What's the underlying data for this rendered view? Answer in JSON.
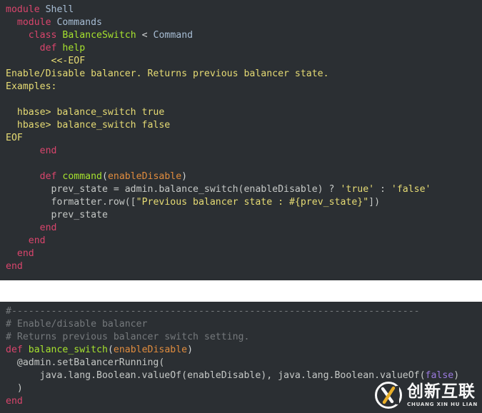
{
  "theme": {
    "panel_background": "#2b2f33",
    "page_background": "#ffffff",
    "default_text": "#c5c8c6",
    "keyword": "#d9456c",
    "class_name": "#a6e22e",
    "constant": "#a7bdd4",
    "string": "#e6db74",
    "parameter": "#e08c3e",
    "comment": "#75797c",
    "literal": "#9b7ae0"
  },
  "panel_top": {
    "language": "ruby",
    "lines": [
      {
        "indent": 0,
        "tokens": [
          {
            "t": "module",
            "c": "kw"
          },
          {
            "t": " ",
            "c": "plain"
          },
          {
            "t": "Shell",
            "c": "cst"
          }
        ]
      },
      {
        "indent": 0,
        "tokens": [
          {
            "t": "  ",
            "c": "plain"
          },
          {
            "t": "module",
            "c": "kw"
          },
          {
            "t": " ",
            "c": "plain"
          },
          {
            "t": "Commands",
            "c": "cst"
          }
        ]
      },
      {
        "indent": 0,
        "tokens": [
          {
            "t": "    ",
            "c": "plain"
          },
          {
            "t": "class",
            "c": "kw"
          },
          {
            "t": " ",
            "c": "plain"
          },
          {
            "t": "BalanceSwitch",
            "c": "cls"
          },
          {
            "t": " ",
            "c": "plain"
          },
          {
            "t": "<",
            "c": "op"
          },
          {
            "t": " ",
            "c": "plain"
          },
          {
            "t": "Command",
            "c": "cst"
          }
        ]
      },
      {
        "indent": 0,
        "tokens": [
          {
            "t": "      ",
            "c": "plain"
          },
          {
            "t": "def",
            "c": "kw"
          },
          {
            "t": " ",
            "c": "plain"
          },
          {
            "t": "help",
            "c": "cls"
          }
        ]
      },
      {
        "indent": 0,
        "tokens": [
          {
            "t": "        <<-EOF",
            "c": "str"
          }
        ]
      },
      {
        "indent": 0,
        "tokens": [
          {
            "t": "Enable/Disable balancer. Returns previous balancer state.",
            "c": "str"
          }
        ]
      },
      {
        "indent": 0,
        "tokens": [
          {
            "t": "Examples:",
            "c": "str"
          }
        ]
      },
      {
        "indent": 0,
        "tokens": [
          {
            "t": "",
            "c": "str"
          }
        ]
      },
      {
        "indent": 0,
        "tokens": [
          {
            "t": "  hbase> balance_switch true",
            "c": "str"
          }
        ]
      },
      {
        "indent": 0,
        "tokens": [
          {
            "t": "  hbase> balance_switch false",
            "c": "str"
          }
        ]
      },
      {
        "indent": 0,
        "tokens": [
          {
            "t": "EOF",
            "c": "str"
          }
        ]
      },
      {
        "indent": 0,
        "tokens": [
          {
            "t": "      ",
            "c": "plain"
          },
          {
            "t": "end",
            "c": "kw"
          }
        ]
      },
      {
        "indent": 0,
        "tokens": [
          {
            "t": "",
            "c": "plain"
          }
        ]
      },
      {
        "indent": 0,
        "tokens": [
          {
            "t": "      ",
            "c": "plain"
          },
          {
            "t": "def",
            "c": "kw"
          },
          {
            "t": " ",
            "c": "plain"
          },
          {
            "t": "command",
            "c": "cls"
          },
          {
            "t": "(",
            "c": "op"
          },
          {
            "t": "enableDisable",
            "c": "par"
          },
          {
            "t": ")",
            "c": "op"
          }
        ]
      },
      {
        "indent": 0,
        "tokens": [
          {
            "t": "        prev_state = admin.balance_switch(enableDisable) ? ",
            "c": "plain"
          },
          {
            "t": "'true'",
            "c": "str"
          },
          {
            "t": " : ",
            "c": "plain"
          },
          {
            "t": "'false'",
            "c": "str"
          }
        ]
      },
      {
        "indent": 0,
        "tokens": [
          {
            "t": "        formatter.row([",
            "c": "plain"
          },
          {
            "t": "\"Previous balancer state : #{prev_state}\"",
            "c": "str"
          },
          {
            "t": "])",
            "c": "plain"
          }
        ]
      },
      {
        "indent": 0,
        "tokens": [
          {
            "t": "        prev_state",
            "c": "plain"
          }
        ]
      },
      {
        "indent": 0,
        "tokens": [
          {
            "t": "      ",
            "c": "plain"
          },
          {
            "t": "end",
            "c": "kw"
          }
        ]
      },
      {
        "indent": 0,
        "tokens": [
          {
            "t": "    ",
            "c": "plain"
          },
          {
            "t": "end",
            "c": "kw"
          }
        ]
      },
      {
        "indent": 0,
        "tokens": [
          {
            "t": "  ",
            "c": "plain"
          },
          {
            "t": "end",
            "c": "kw"
          }
        ]
      },
      {
        "indent": 0,
        "tokens": [
          {
            "t": "end",
            "c": "kw"
          }
        ]
      }
    ]
  },
  "panel_bottom": {
    "language": "ruby",
    "lines": [
      {
        "indent": 0,
        "tokens": [
          {
            "t": "#------------------------------------------------------------------------",
            "c": "cmt"
          }
        ]
      },
      {
        "indent": 0,
        "tokens": [
          {
            "t": "# Enable/disable balancer",
            "c": "cmt"
          }
        ]
      },
      {
        "indent": 0,
        "tokens": [
          {
            "t": "# Returns previous balancer switch setting.",
            "c": "cmt"
          }
        ]
      },
      {
        "indent": 0,
        "tokens": [
          {
            "t": "def",
            "c": "kw"
          },
          {
            "t": " ",
            "c": "plain"
          },
          {
            "t": "balance_switch",
            "c": "cls"
          },
          {
            "t": "(",
            "c": "op"
          },
          {
            "t": "enableDisable",
            "c": "par"
          },
          {
            "t": ")",
            "c": "op"
          }
        ]
      },
      {
        "indent": 0,
        "tokens": [
          {
            "t": "  @admin.setBalancerRunning(",
            "c": "plain"
          }
        ]
      },
      {
        "indent": 0,
        "tokens": [
          {
            "t": "      java.lang.Boolean.valueOf(enableDisable), java.lang.Boolean.valueOf(",
            "c": "plain"
          },
          {
            "t": "false",
            "c": "lit"
          },
          {
            "t": ")",
            "c": "plain"
          }
        ]
      },
      {
        "indent": 0,
        "tokens": [
          {
            "t": "  )",
            "c": "plain"
          }
        ]
      },
      {
        "indent": 0,
        "tokens": [
          {
            "t": "end",
            "c": "kw"
          }
        ]
      }
    ]
  },
  "watermark": {
    "chinese": "创新互联",
    "pinyin": "CHUANG XIN HU LIAN",
    "logo_letter": "X"
  }
}
